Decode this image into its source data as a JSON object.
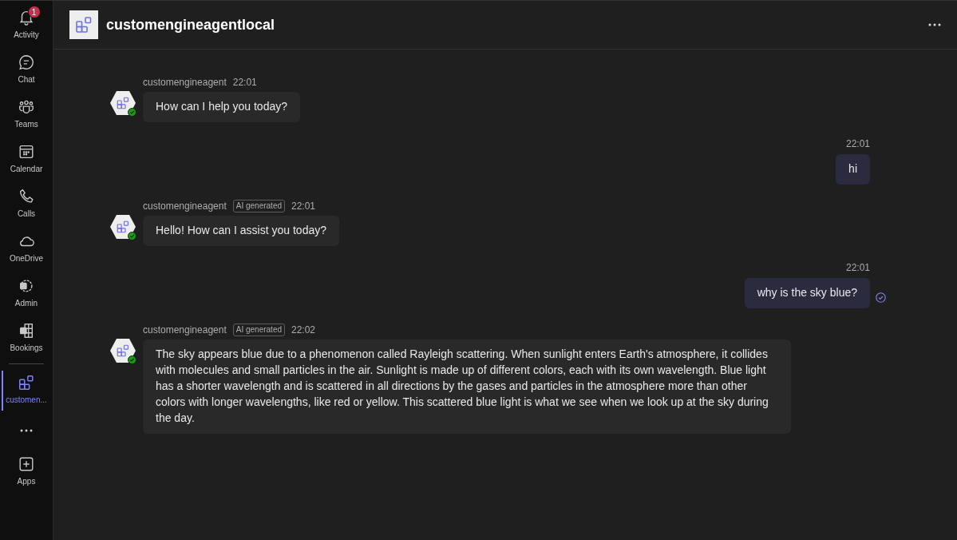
{
  "rail": {
    "items": [
      {
        "label": "Activity",
        "selected": false,
        "badge": "1"
      },
      {
        "label": "Chat",
        "selected": false
      },
      {
        "label": "Teams",
        "selected": false
      },
      {
        "label": "Calendar",
        "selected": false
      },
      {
        "label": "Calls",
        "selected": false
      },
      {
        "label": "OneDrive",
        "selected": false
      },
      {
        "label": "Admin",
        "selected": false
      },
      {
        "label": "Bookings",
        "selected": false
      },
      {
        "label": "customen...",
        "selected": true
      }
    ],
    "apps": {
      "label": "Apps"
    }
  },
  "header": {
    "title": "customengineagentlocal"
  },
  "messages": [
    {
      "kind": "bot",
      "sender": "customengineagent",
      "time": "22:01",
      "text": "How can I help you today?"
    },
    {
      "kind": "user",
      "time": "22:01",
      "text": "hi",
      "seen": false
    },
    {
      "kind": "bot",
      "sender": "customengineagent",
      "tag": "AI generated",
      "time": "22:01",
      "text": "Hello! How can I assist you today?"
    },
    {
      "kind": "user",
      "time": "22:01",
      "text": "why is the sky blue?",
      "seen": true
    },
    {
      "kind": "bot",
      "sender": "customengineagent",
      "tag": "AI generated",
      "time": "22:02",
      "text": "The sky appears blue due to a phenomenon called Rayleigh scattering. When sunlight enters Earth's atmosphere, it collides with molecules and small particles in the air. Sunlight is made up of different colors, each with its own wavelength. Blue light has a shorter wavelength and is scattered in all directions by the gases and particles in the atmosphere more than other colors with longer wavelengths, like red or yellow. This scattered blue light is what we see when we look up at the sky during the day."
    }
  ]
}
